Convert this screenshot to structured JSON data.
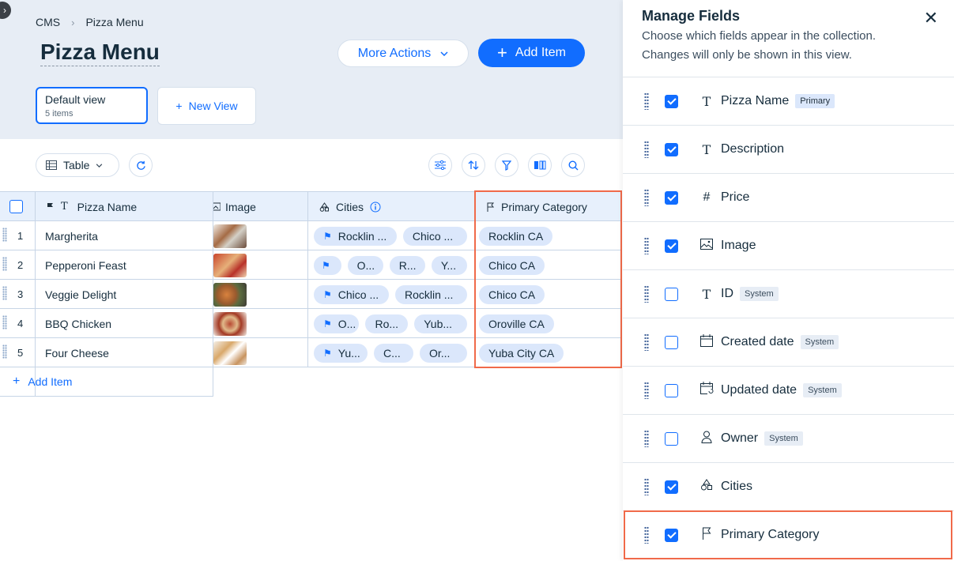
{
  "breadcrumb": {
    "root": "CMS",
    "current": "Pizza Menu"
  },
  "page_title": "Pizza Menu",
  "actions": {
    "more": "More Actions",
    "add": "Add Item"
  },
  "views": {
    "default_title": "Default view",
    "default_count": "5 items",
    "new": "New View"
  },
  "toolbar": {
    "table": "Table"
  },
  "table": {
    "columns": {
      "name": "Pizza Name",
      "image": "Image",
      "cities": "Cities",
      "primary": "Primary Category"
    },
    "rows": [
      {
        "num": "1",
        "name": "Margherita",
        "cities": [
          "Rocklin ...",
          "Chico ..."
        ],
        "primary": "Rocklin CA"
      },
      {
        "num": "2",
        "name": "Pepperoni Feast",
        "cities": [
          "O...",
          "R...",
          "Y..."
        ],
        "primary": "Chico CA"
      },
      {
        "num": "3",
        "name": "Veggie Delight",
        "cities": [
          "Chico ...",
          "Rocklin ..."
        ],
        "primary": "Chico CA"
      },
      {
        "num": "4",
        "name": "BBQ Chicken",
        "cities": [
          "O...",
          "Ro...",
          "Yub..."
        ],
        "primary": "Oroville CA"
      },
      {
        "num": "5",
        "name": "Four Cheese",
        "cities": [
          "Yu...",
          "C...",
          "Or..."
        ],
        "primary": "Yuba City CA"
      }
    ],
    "add_item": "Add Item"
  },
  "panel": {
    "title": "Manage Fields",
    "subtitle": "Choose which fields appear in the collection. Changes will only be shown in this view.",
    "fields": [
      {
        "name": "Pizza Name",
        "icon": "text-icon",
        "checked": true,
        "tag": "Primary"
      },
      {
        "name": "Description",
        "icon": "text-icon",
        "checked": true,
        "tag": ""
      },
      {
        "name": "Price",
        "icon": "hash-icon",
        "checked": true,
        "tag": ""
      },
      {
        "name": "Image",
        "icon": "image-icon",
        "checked": true,
        "tag": ""
      },
      {
        "name": "ID",
        "icon": "text-icon",
        "checked": false,
        "tag": "System"
      },
      {
        "name": "Created date",
        "icon": "calendar-icon",
        "checked": false,
        "tag": "System"
      },
      {
        "name": "Updated date",
        "icon": "calendar-refresh-icon",
        "checked": false,
        "tag": "System"
      },
      {
        "name": "Owner",
        "icon": "person-icon",
        "checked": false,
        "tag": "System"
      },
      {
        "name": "Cities",
        "icon": "shapes-icon",
        "checked": true,
        "tag": ""
      },
      {
        "name": "Primary Category",
        "icon": "flag-icon",
        "checked": true,
        "tag": ""
      }
    ]
  },
  "colors": {
    "accent": "#116dff",
    "highlight": "#f06a4a",
    "header_bg": "#e7edf5"
  }
}
